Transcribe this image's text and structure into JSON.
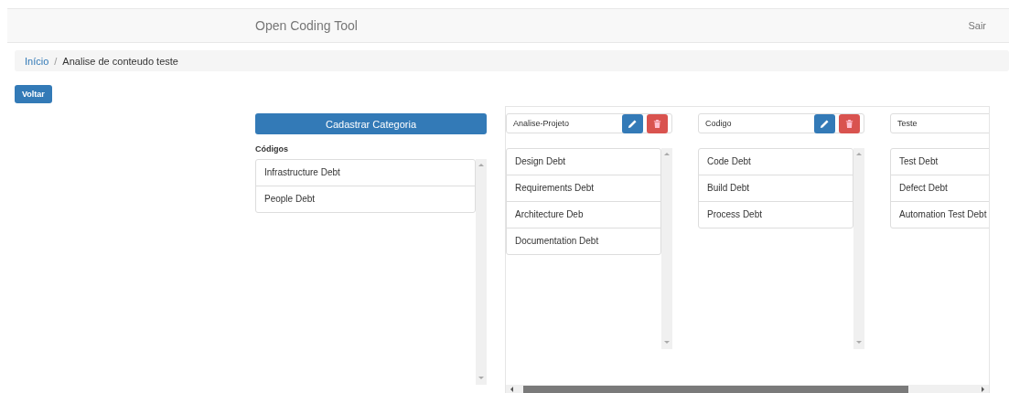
{
  "navbar": {
    "title": "Open Coding Tool",
    "logout": "Sair"
  },
  "breadcrumb_separator": "/",
  "breadcrumb": [
    {
      "label": "Início",
      "kind": "link"
    },
    {
      "label": "Analise de conteudo teste",
      "kind": "current"
    }
  ],
  "back_button": "Voltar",
  "codes_panel": {
    "button": "Cadastrar Categoria",
    "heading": "Códigos",
    "items": [
      "Infrastructure Debt",
      "People Debt"
    ]
  },
  "categories": [
    {
      "name": "Analise-Projeto",
      "codes": [
        "Design Debt",
        "Requirements Debt",
        "Architecture Deb",
        "Documentation Debt"
      ]
    },
    {
      "name": "Codigo",
      "codes": [
        "Code Debt",
        "Build Debt",
        "Process Debt"
      ]
    },
    {
      "name": "Teste",
      "codes": [
        "Test Debt",
        "Defect Debt",
        "Automation Test Debt"
      ]
    }
  ]
}
